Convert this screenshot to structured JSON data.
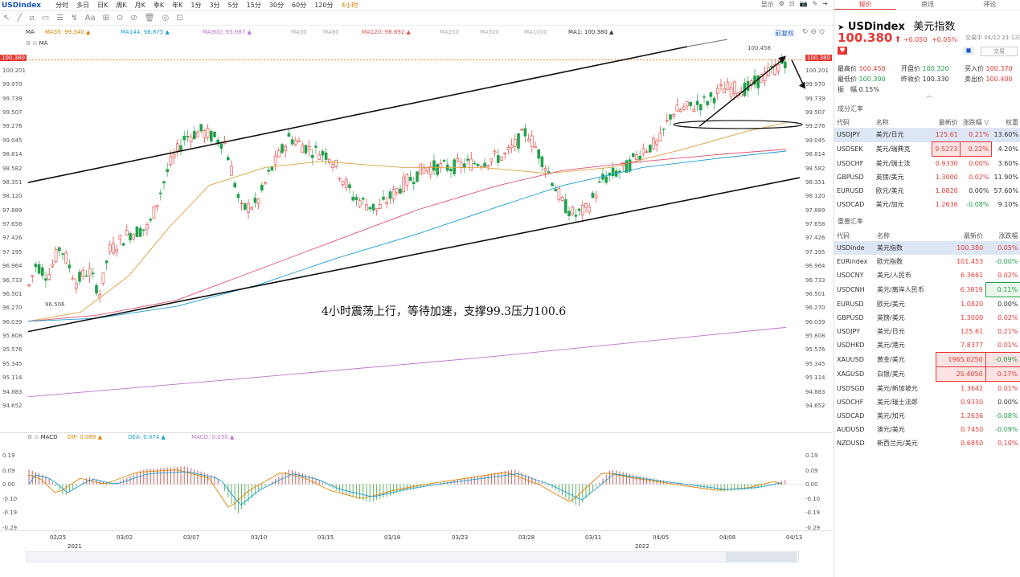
{
  "topbar": {
    "symbol": "USDindex",
    "tabs": [
      "分时",
      "多日",
      "日K",
      "周K",
      "月K",
      "季K",
      "年K",
      "1分",
      "3分",
      "5分",
      "15分",
      "30分",
      "60分",
      "120分",
      "4小时"
    ],
    "active_tab": "4小时",
    "right": [
      "显示",
      "⚙",
      "⊡",
      "📷",
      "✎",
      "➜"
    ]
  },
  "ma_legend": [
    {
      "label": "MA",
      "color": "#333"
    },
    {
      "label": "MA55: 99.340 ▲",
      "color": "#e08000"
    },
    {
      "label": "MA144: 98.875 ▲",
      "color": "#1a9fd8"
    },
    {
      "label": "MA900: 95.987 ▲",
      "color": "#c070d0"
    },
    {
      "label": "MA30",
      "color": "#aaa"
    },
    {
      "label": "MA60",
      "color": "#aaa"
    },
    {
      "label": "MA120: 98.892 ▲",
      "color": "#e05050"
    },
    {
      "label": "MA250",
      "color": "#aaa"
    },
    {
      "label": "MA500",
      "color": "#aaa"
    },
    {
      "label": "MA1000",
      "color": "#aaa"
    },
    {
      "label": "MA1: 100.380 ▲",
      "color": "#333"
    }
  ],
  "ma_legend2": "MA",
  "restore_label": "前复权",
  "price_axis": [
    "100.201",
    "99.970",
    "99.739",
    "99.507",
    "99.276",
    "99.045",
    "98.814",
    "98.582",
    "98.351",
    "98.120",
    "97.889",
    "97.658",
    "97.426",
    "97.195",
    "96.964",
    "96.733",
    "96.501",
    "96.270",
    "96.039",
    "95.808",
    "95.576",
    "95.345",
    "95.114",
    "94.883",
    "94.652"
  ],
  "price_axis_left": [
    "100.201",
    "99.970",
    "99.739",
    "99.507",
    "99.276",
    "99.045",
    "98.814",
    "98.582",
    "98.351",
    "98.120",
    "97.889",
    "97.658",
    "97.426",
    "97.195",
    "96.964",
    "96.733",
    "96.501",
    "96.270",
    "96.039",
    "95.808",
    "95.576",
    "95.345",
    "95.114",
    "94.883",
    "94.652"
  ],
  "last_price_tag": "100.380",
  "high_label": "100.458",
  "low_label": "96.506",
  "annotation": "4小时震荡上行，等待加速，支撑99.3压力100.6",
  "macd_legend": {
    "name": "MACD",
    "dif": "DIF: 0.089 ▲",
    "dea": "DEA: 0.074 ▲",
    "macd": "MACD: 0.030 ▲"
  },
  "macd_axis": [
    "0.19",
    "0.09",
    "0.00",
    "-0.10",
    "-0.19",
    "-0.29"
  ],
  "x_dates": [
    "02/25",
    "03/02",
    "03/07",
    "03/10",
    "03/15",
    "03/18",
    "03/23",
    "03/28",
    "03/31",
    "04/05",
    "04/08",
    "04/13"
  ],
  "x_years": [
    "2021",
    "2022"
  ],
  "panel": {
    "tabs": [
      "报价",
      "资讯",
      "评论"
    ],
    "active_tab": "报价",
    "symbol": "USDindex",
    "name": "美元指数",
    "price": "100.380",
    "change": "+0.050",
    "pct": "+0.05%",
    "time": "交易中 04/12 21:12(北京)",
    "trade_button": "交易",
    "stats": [
      {
        "k": "最高价",
        "v": "100.450",
        "c": "pos"
      },
      {
        "k": "开盘价",
        "v": "100.320",
        "c": "neg"
      },
      {
        "k": "买入价",
        "v": "100.370",
        "c": "pos"
      },
      {
        "k": "最低价",
        "v": "100.300",
        "c": "neg"
      },
      {
        "k": "昨收价",
        "v": "100.330",
        "c": ""
      },
      {
        "k": "卖出价",
        "v": "100.400",
        "c": "pos"
      },
      {
        "k": "振　幅",
        "v": "0.15%",
        "c": ""
      }
    ],
    "section1": "成分汇率",
    "section1_headers": [
      "代码",
      "名称",
      "最新价",
      "涨跌幅 ▽",
      "权重"
    ],
    "section1_rows": [
      {
        "code": "USDJPY",
        "name": "美元/日元",
        "price": "125.61",
        "pct": "0.21%",
        "w": "13.60%",
        "pc": "pos",
        "selected": true,
        "box": ""
      },
      {
        "code": "USDSEK",
        "name": "美元/瑞典克",
        "price": "9.5273",
        "pct": "0.22%",
        "w": "4.20%",
        "pc": "pos",
        "selected": false,
        "box": "r"
      },
      {
        "code": "USDCHF",
        "name": "美元/瑞士法",
        "price": "0.9330",
        "pct": "0.00%",
        "w": "3.60%",
        "pc": "pos",
        "selected": false,
        "box": ""
      },
      {
        "code": "GBPUSD",
        "name": "英镑/美元",
        "price": "1.3000",
        "pct": "0.02%",
        "w": "11.90%",
        "pc": "pos",
        "selected": false,
        "box": ""
      },
      {
        "code": "EURUSD",
        "name": "欧元/美元",
        "price": "1.0820",
        "pct": "0.00%",
        "w": "57.60%",
        "pc": "",
        "selected": false,
        "box": ""
      },
      {
        "code": "USDCAD",
        "name": "美元/加元",
        "price": "1.2636",
        "pct": "-0.08%",
        "w": "9.10%",
        "pc": "neg",
        "selected": false,
        "box": ""
      }
    ],
    "section2": "重要汇率",
    "section2_headers": [
      "代码",
      "名称",
      "最新价",
      "涨跌幅"
    ],
    "section2_rows": [
      {
        "code": "USDinde",
        "name": "美元指数",
        "price": "100.380",
        "pct": "0.05%",
        "pc": "pos",
        "selected": true,
        "box": ""
      },
      {
        "code": "EURindex",
        "name": "欧元指数",
        "price": "101.453",
        "pct": "-0.00%",
        "pc": "neg",
        "selected": false,
        "box": ""
      },
      {
        "code": "USDCNY",
        "name": "美元/人民币",
        "price": "6.3661",
        "pct": "0.02%",
        "pc": "pos",
        "selected": false,
        "box": ""
      },
      {
        "code": "USDCNH",
        "name": "美元/离岸人民币",
        "price": "6.3819",
        "pct": "0.11%",
        "pc": "neg",
        "selected": false,
        "box": "g"
      },
      {
        "code": "EURUSD",
        "name": "欧元/美元",
        "price": "1.0820",
        "pct": "0.00%",
        "pc": "",
        "selected": false,
        "box": ""
      },
      {
        "code": "GBPUSD",
        "name": "英镑/美元",
        "price": "1.3000",
        "pct": "0.02%",
        "pc": "pos",
        "selected": false,
        "box": ""
      },
      {
        "code": "USDJPY",
        "name": "美元/日元",
        "price": "125.61",
        "pct": "0.21%",
        "pc": "pos",
        "selected": false,
        "box": ""
      },
      {
        "code": "USDHKD",
        "name": "美元/港元",
        "price": "7.8377",
        "pct": "0.01%",
        "pc": "pos",
        "selected": false,
        "box": ""
      },
      {
        "code": "XAUUSD",
        "name": "黄金/美元",
        "price": "1965.0250",
        "pct": "-0.09%",
        "pc": "neg",
        "selected": false,
        "box": "r"
      },
      {
        "code": "XAGUSD",
        "name": "白银/美元",
        "price": "25.4050",
        "pct": "0.17%",
        "pc": "pos",
        "selected": false,
        "box": "r"
      },
      {
        "code": "USDSGD",
        "name": "美元/新加坡元",
        "price": "1.3642",
        "pct": "0.01%",
        "pc": "pos",
        "selected": false,
        "box": ""
      },
      {
        "code": "USDCHF",
        "name": "美元/瑞士法郎",
        "price": "0.9330",
        "pct": "0.00%",
        "pc": "",
        "selected": false,
        "box": ""
      },
      {
        "code": "USDCAD",
        "name": "美元/加元",
        "price": "1.2636",
        "pct": "-0.08%",
        "pc": "neg",
        "selected": false,
        "box": ""
      },
      {
        "code": "AUDUSD",
        "name": "澳元/美元",
        "price": "0.7450",
        "pct": "-0.09%",
        "pc": "neg",
        "selected": false,
        "box": ""
      },
      {
        "code": "NZDUSD",
        "name": "新西兰元/美元",
        "price": "0.6850",
        "pct": "0.10%",
        "pc": "pos",
        "selected": false,
        "box": ""
      }
    ]
  }
}
